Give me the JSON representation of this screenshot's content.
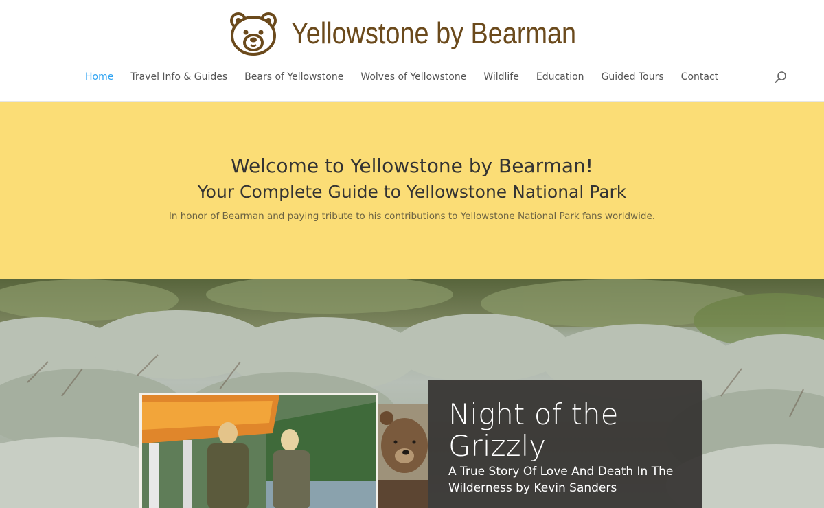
{
  "site": {
    "name": "Yellowstone by Bearman",
    "brand_color": "#6b4a1c",
    "logo_icon": "bear-face-icon"
  },
  "nav": {
    "items": [
      {
        "label": "Home",
        "active": true
      },
      {
        "label": "Travel Info & Guides",
        "active": false
      },
      {
        "label": "Bears of Yellowstone",
        "active": false
      },
      {
        "label": "Wolves of Yellowstone",
        "active": false
      },
      {
        "label": "Wildlife",
        "active": false
      },
      {
        "label": "Education",
        "active": false
      },
      {
        "label": "Guided Tours",
        "active": false
      },
      {
        "label": "Contact",
        "active": false
      }
    ],
    "active_color": "#2ea3f2",
    "search_icon": "search-icon"
  },
  "welcome": {
    "title": "Welcome to Yellowstone by Bearman!",
    "subtitle": "Your Complete Guide to Yellowstone National Park",
    "tagline": "In honor of Bearman and paying tribute to his contributions to Yellowstone National Park fans worldwide.",
    "background": "#fbdd76"
  },
  "hero": {
    "book_title": "Night of the Grizzly",
    "book_subtitle": "A True Story Of Love And Death In The Wilderness by Kevin Sanders"
  }
}
